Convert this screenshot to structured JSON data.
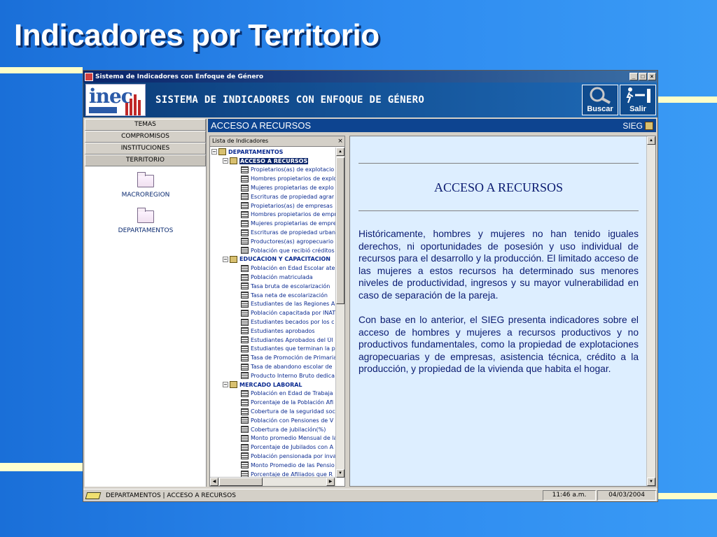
{
  "slide": {
    "title": "Indicadores por Territorio"
  },
  "window": {
    "title": "Sistema de Indicadores con Enfoque de Género",
    "controls": {
      "minimize": "_",
      "maximize": "□",
      "close": "×"
    }
  },
  "header": {
    "logo_text": "inec",
    "title": "SISTEMA DE INDICADORES CON ENFOQUE DE GÉNERO",
    "buscar_label": "Buscar",
    "salir_label": "Salir"
  },
  "nav": {
    "buttons": [
      {
        "label": "TEMAS"
      },
      {
        "label": "COMPROMISOS"
      },
      {
        "label": "INSTITUCIONES"
      },
      {
        "label": "TERRITORIO"
      }
    ],
    "folders": [
      {
        "label": "MACROREGION"
      },
      {
        "label": "DEPARTAMENTOS"
      }
    ]
  },
  "content": {
    "header_title": "ACCESO A RECURSOS",
    "header_right": "SIEG"
  },
  "list": {
    "title": "Lista de Indicadores",
    "close": "×",
    "rows": [
      {
        "label": "DEPARTAMENTOS"
      },
      {
        "label": "ACCESO A RECURSOS"
      },
      {
        "label": "Propietarios(as) de explotacio"
      },
      {
        "label": "Hombres propietarios de explo"
      },
      {
        "label": "Mujeres propietarias de explo"
      },
      {
        "label": "Escrituras de propiedad agrar"
      },
      {
        "label": "Propietarios(as) de empresas"
      },
      {
        "label": "Hombres propietarios de empr"
      },
      {
        "label": "Mujeres propietarias de empre"
      },
      {
        "label": "Escrituras de propiedad urban"
      },
      {
        "label": "Productores(as) agropecuario"
      },
      {
        "label": "Población que recibió créditos"
      },
      {
        "label": "EDUCACIÓN Y CAPACITACIÓN"
      },
      {
        "label": "Población en Edad Escolar ate"
      },
      {
        "label": "Población matriculada"
      },
      {
        "label": "Tasa bruta de escolarización"
      },
      {
        "label": "Tasa neta de escolarización"
      },
      {
        "label": "Estudiantes de las Regiones A"
      },
      {
        "label": "Población capacitada por INAT"
      },
      {
        "label": "Estudiantes becados por los c"
      },
      {
        "label": "Estudiantes aprobados"
      },
      {
        "label": "Estudiantes Aprobados del Úl"
      },
      {
        "label": "Estudiantes que terminan la p"
      },
      {
        "label": "Tasa de Promoción de Primaria"
      },
      {
        "label": "Tasa de abandono escolar de"
      },
      {
        "label": "Producto Interno Bruto dedica"
      },
      {
        "label": "MERCADO LABORAL"
      },
      {
        "label": "Población en Edad de Trabaja"
      },
      {
        "label": "Porcentaje de la Población Afi"
      },
      {
        "label": "Cobertura de la seguridad soc"
      },
      {
        "label": "Población con Pensiones de V"
      },
      {
        "label": "Cobertura de jubilación(%)"
      },
      {
        "label": "Monto promedio Mensual de la"
      },
      {
        "label": "Porcentaje de Jubilados con A"
      },
      {
        "label": "Población pensionada por inva"
      },
      {
        "label": "Monto Promedio de las Pensio"
      },
      {
        "label": "Porcentaje de Afiliados que R"
      }
    ]
  },
  "article": {
    "title": "ACCESO A RECURSOS",
    "para1": "Históricamente, hombres y mujeres no han tenido iguales derechos, ni oportunidades de posesión y uso individual de recursos para el desarrollo y la producción. El limitado acceso de las mujeres a estos recursos ha determinado sus menores niveles de productividad, ingresos y su mayor vulnerabilidad en caso de separación de la pareja.",
    "para2": "Con base en lo anterior, el SIEG presenta indicadores sobre el acceso de hombres y mujeres a recursos productivos y no productivos fundamentales, como la propiedad de explotaciones agropecuarias y de empresas, asistencia técnica, crédito a la producción, y propiedad de la vivienda que habita el hogar."
  },
  "status": {
    "path": "DEPARTAMENTOS | ACCESO A RECURSOS",
    "time": "11:46 a.m.",
    "date": "04/03/2004"
  }
}
